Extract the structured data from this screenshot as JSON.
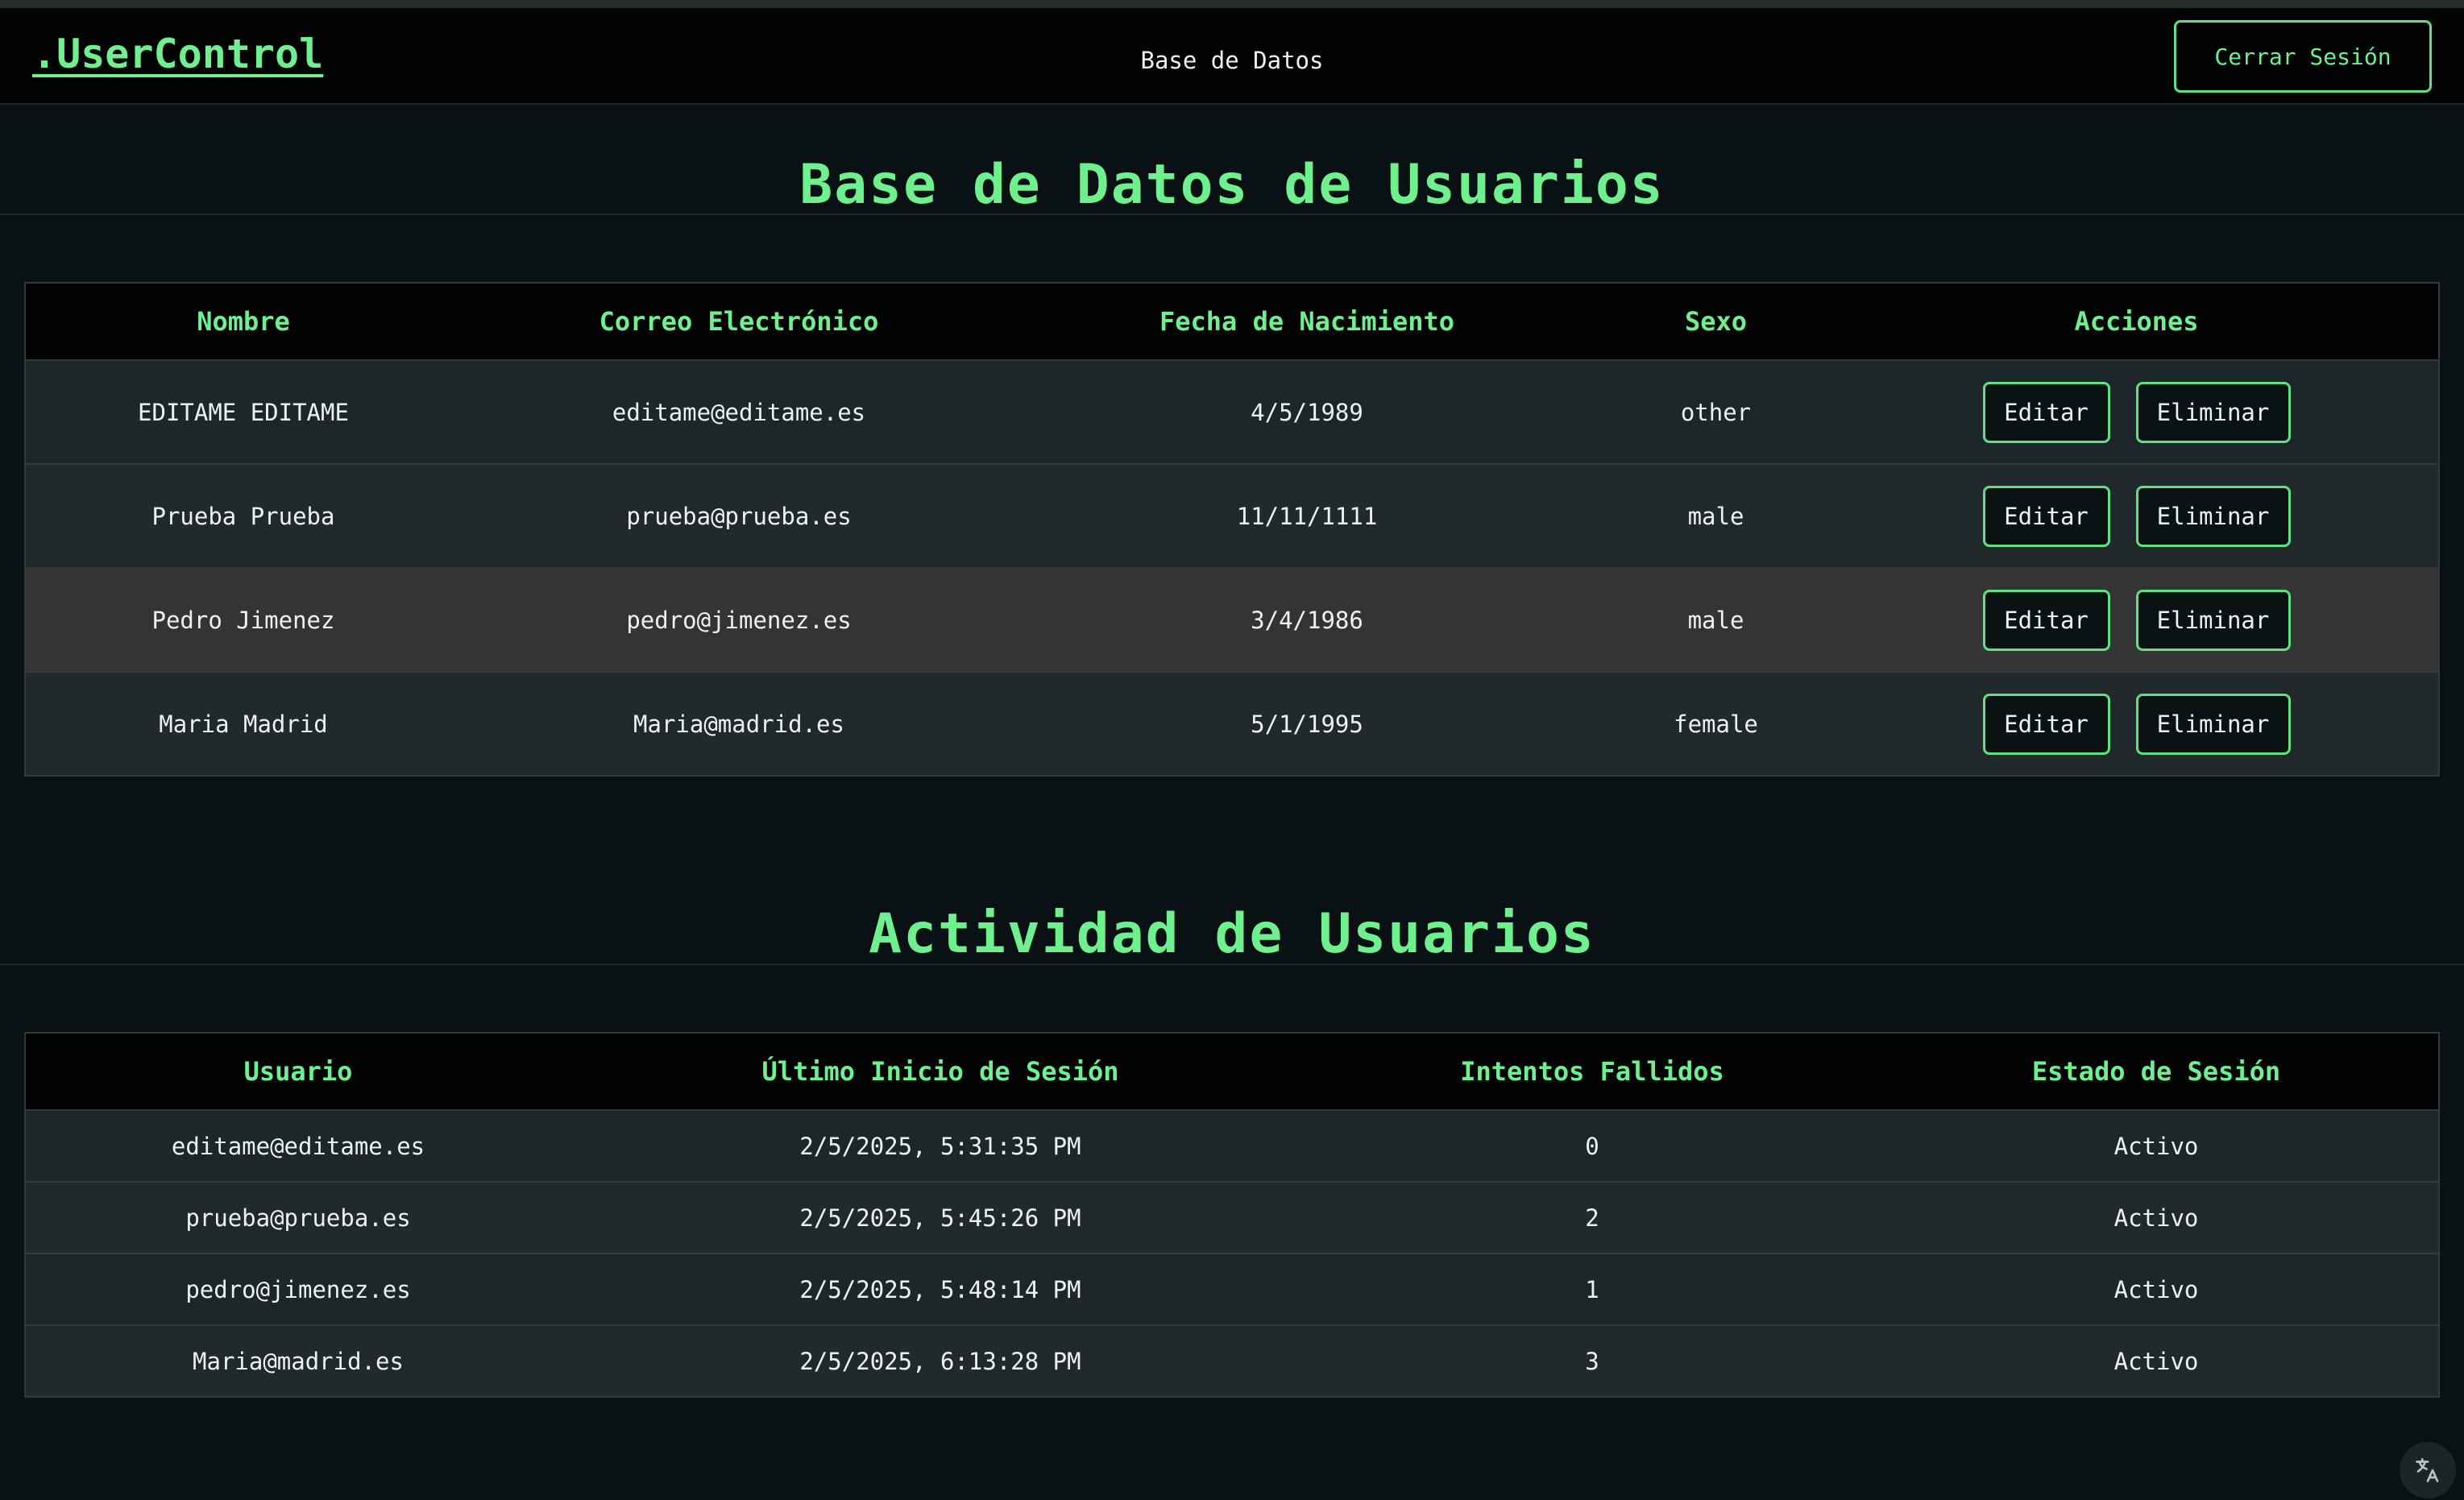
{
  "navbar": {
    "logo": ".UserControl",
    "center_link": "Base de Datos",
    "logout_label": "Cerrar Sesión"
  },
  "users_section": {
    "title": "Base de Datos de Usuarios",
    "columns": [
      "Nombre",
      "Correo Electrónico",
      "Fecha de Nacimiento",
      "Sexo",
      "Acciones"
    ],
    "edit_label": "Editar",
    "delete_label": "Eliminar",
    "rows": [
      {
        "name": "EDITAME EDITAME",
        "email": "editame@editame.es",
        "birth": "4/5/1989",
        "sex": "other"
      },
      {
        "name": "Prueba Prueba",
        "email": "prueba@prueba.es",
        "birth": "11/11/1111",
        "sex": "male"
      },
      {
        "name": "Pedro Jimenez",
        "email": "pedro@jimenez.es",
        "birth": "3/4/1986",
        "sex": "male"
      },
      {
        "name": "Maria Madrid",
        "email": "Maria@madrid.es",
        "birth": "5/1/1995",
        "sex": "female"
      }
    ]
  },
  "activity_section": {
    "title": "Actividad de Usuarios",
    "columns": [
      "Usuario",
      "Último Inicio de Sesión",
      "Intentos Fallidos",
      "Estado de Sesión"
    ],
    "rows": [
      {
        "user": "editame@editame.es",
        "last_login": "2/5/2025, 5:31:35 PM",
        "failed": "0",
        "status": "Activo"
      },
      {
        "user": "prueba@prueba.es",
        "last_login": "2/5/2025, 5:45:26 PM",
        "failed": "2",
        "status": "Activo"
      },
      {
        "user": "pedro@jimenez.es",
        "last_login": "2/5/2025, 5:48:14 PM",
        "failed": "1",
        "status": "Activo"
      },
      {
        "user": "Maria@madrid.es",
        "last_login": "2/5/2025, 6:13:28 PM",
        "failed": "3",
        "status": "Activo"
      }
    ]
  },
  "translate_icon": "translate-icon",
  "colors": {
    "accent": "#6ff08e",
    "background": "#0a1114",
    "header_bg": "#010303"
  }
}
